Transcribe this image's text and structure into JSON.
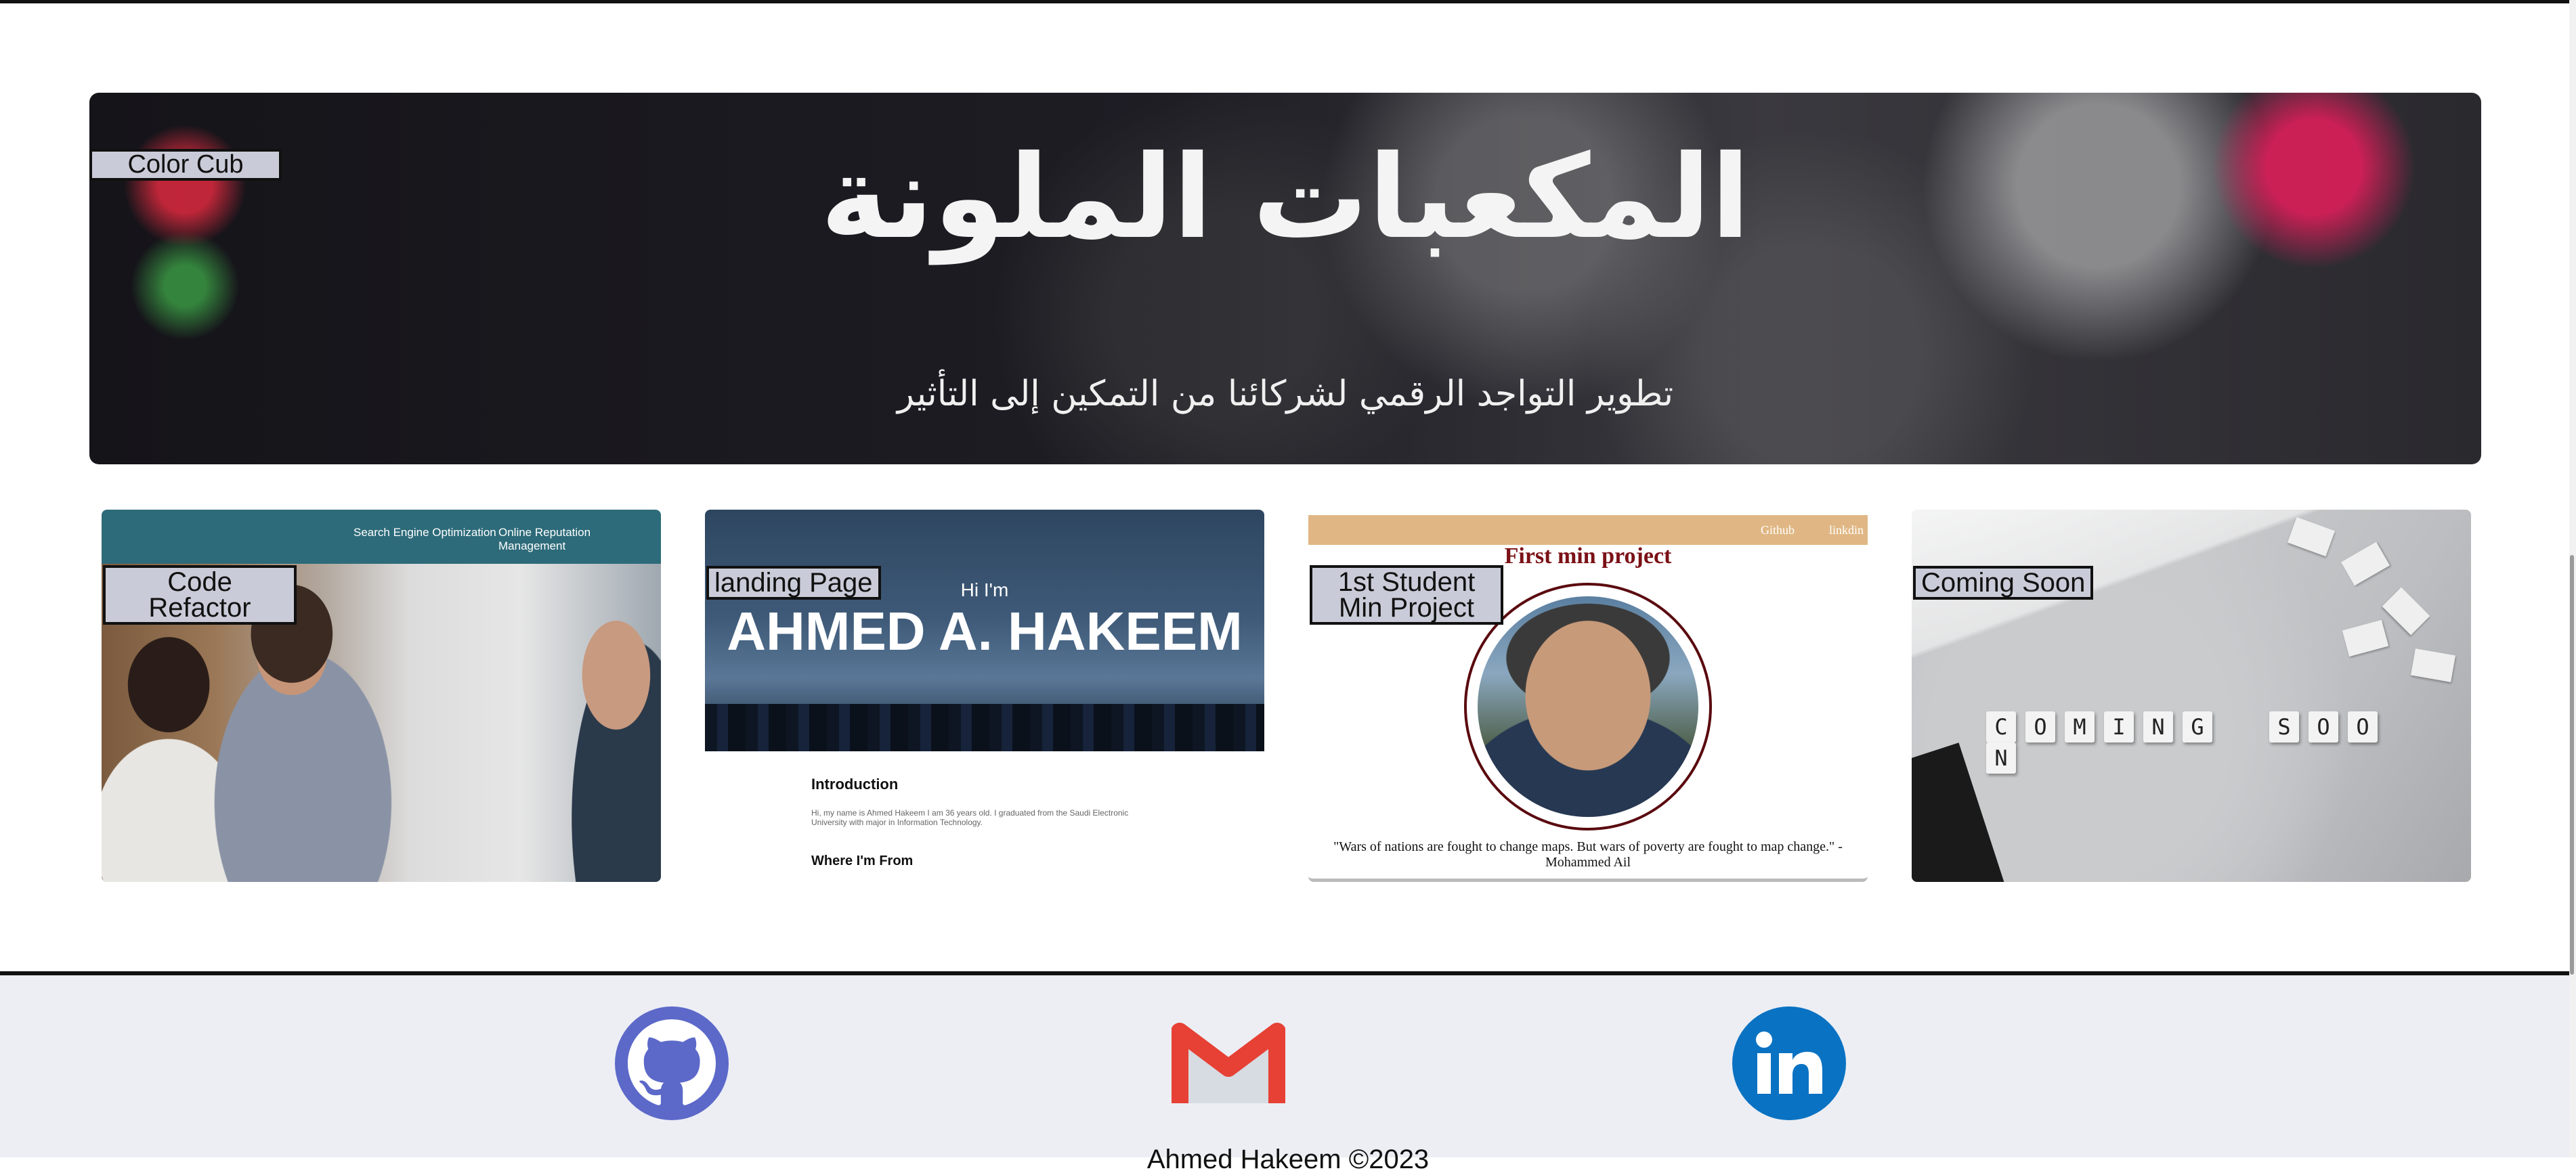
{
  "hero": {
    "label": "Color Cub",
    "title": "المكعبات الملونة",
    "subtitle": "تطوير التواجد الرقمي لشركائنا من التمكين إلى التأثير"
  },
  "cards": [
    {
      "label_line1": "Code",
      "label_line2": "Refactor",
      "nav": [
        "Search Engine Optimization",
        "Online Reputation Management"
      ]
    },
    {
      "label": "landing Page",
      "greeting": "Hi I'm",
      "name": "AHMED A. HAKEEM",
      "intro_heading": "Introduction",
      "intro_text": "Hi, my name is Ahmed Hakeem I am 36 years old. I graduated from the Saudi Electronic University with major in Information Technology.",
      "from_heading": "Where I'm From"
    },
    {
      "label_line1": "1st Student",
      "label_line2": "Min Project",
      "nav": [
        "Github",
        "linkdin"
      ],
      "title": "First min project",
      "quote": "\"Wars of nations are fought to change maps. But wars of poverty are fought to map change.\" - Mohammed Ail"
    },
    {
      "label": "Coming Soon",
      "tiles_word1": [
        "C",
        "O",
        "M",
        "I",
        "N",
        "G"
      ],
      "tiles_word2": [
        "S",
        "O",
        "O",
        "N"
      ]
    }
  ],
  "footer": {
    "icons": [
      "github-icon",
      "gmail-icon",
      "linkedin-icon"
    ],
    "text": "Ahmed Hakeem ©2023"
  },
  "colors": {
    "label_bg": "#c9ccd8",
    "github": "#5c69c9",
    "linkedin": "#0a72c2",
    "gmail_red": "#e64134"
  }
}
